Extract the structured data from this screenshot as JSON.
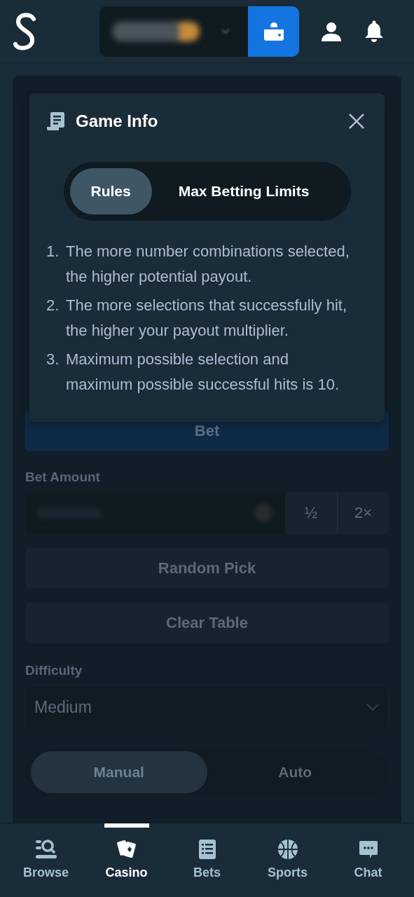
{
  "game_panel": {
    "bet_button": "Bet",
    "bet_amount": {
      "label": "Bet Amount",
      "half": "½",
      "double": "2×"
    },
    "random_pick": "Random Pick",
    "clear_table": "Clear Table",
    "difficulty": {
      "label": "Difficulty",
      "value": "Medium"
    },
    "mode_tabs": [
      {
        "label": "Manual",
        "selected": true
      },
      {
        "label": "Auto",
        "selected": false
      }
    ]
  },
  "modal": {
    "title": "Game Info",
    "tabs": [
      {
        "label": "Rules",
        "selected": true
      },
      {
        "label": "Max Betting Limits",
        "selected": false
      }
    ],
    "rules": [
      {
        "number": "1.",
        "text": "The more number combinations selected, the higher potential payout."
      },
      {
        "number": "2.",
        "text": "The more selections that successfully hit, the higher your payout multiplier."
      },
      {
        "number": "3.",
        "text": "Maximum possible selection and maximum possible successful hits is 10."
      }
    ]
  },
  "bottom_nav": [
    {
      "label": "Browse",
      "kind": "browse",
      "selected": false
    },
    {
      "label": "Casino",
      "kind": "casino",
      "selected": true
    },
    {
      "label": "Bets",
      "kind": "bets",
      "selected": false
    },
    {
      "label": "Sports",
      "kind": "sports",
      "selected": false
    },
    {
      "label": "Chat",
      "kind": "chat",
      "selected": false
    }
  ]
}
